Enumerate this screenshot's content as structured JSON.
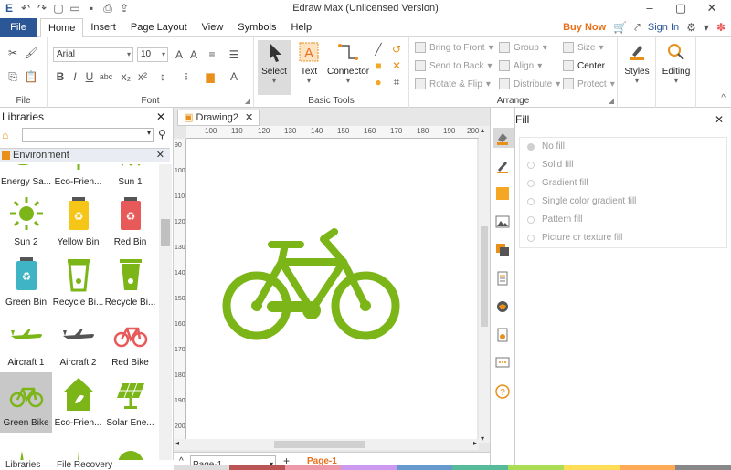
{
  "window": {
    "title": "Edraw Max (Unlicensed Version)"
  },
  "menu": {
    "file": "File",
    "tabs": [
      "Home",
      "Insert",
      "Page Layout",
      "View",
      "Symbols",
      "Help"
    ],
    "buy_now": "Buy Now",
    "sign_in": "Sign In"
  },
  "ribbon": {
    "file_group": "File",
    "font_group": "Font",
    "font_name": "Arial",
    "font_size": "10",
    "basic_tools_group": "Basic Tools",
    "select": "Select",
    "text": "Text",
    "connector": "Connector",
    "arrange_group": "Arrange",
    "bring_to_front": "Bring to Front",
    "send_to_back": "Send to Back",
    "rotate_flip": "Rotate & Flip",
    "group": "Group",
    "align": "Align",
    "distribute": "Distribute",
    "size": "Size",
    "center": "Center",
    "protect": "Protect",
    "styles": "Styles",
    "editing": "Editing"
  },
  "libraries": {
    "title": "Libraries",
    "category": "Environment",
    "items": [
      {
        "name": "Energy Sa..."
      },
      {
        "name": "Eco-Frien..."
      },
      {
        "name": "Sun 1"
      },
      {
        "name": "Sun 2"
      },
      {
        "name": "Yellow Bin"
      },
      {
        "name": "Red Bin"
      },
      {
        "name": "Green Bin"
      },
      {
        "name": "Recycle Bi..."
      },
      {
        "name": "Recycle Bi..."
      },
      {
        "name": "Aircraft 1"
      },
      {
        "name": "Aircraft 2"
      },
      {
        "name": "Red Bike"
      },
      {
        "name": "Green Bike"
      },
      {
        "name": "Eco-Frien..."
      },
      {
        "name": "Solar Ene..."
      }
    ],
    "footer_libraries": "Libraries",
    "footer_file_recovery": "File Recovery"
  },
  "document": {
    "tab": "Drawing2",
    "ruler_h": [
      "100",
      "110",
      "120",
      "130",
      "140",
      "150",
      "160",
      "170",
      "180",
      "190",
      "200"
    ],
    "ruler_v": [
      "90",
      "100",
      "110",
      "120",
      "130",
      "140",
      "150",
      "160",
      "170",
      "180",
      "190",
      "200"
    ],
    "page_select": "Page-1",
    "active_page": "Page-1"
  },
  "fill": {
    "title": "Fill",
    "options": [
      "No fill",
      "Solid fill",
      "Gradient fill",
      "Single color gradient fill",
      "Pattern fill",
      "Picture or texture fill"
    ],
    "selected_index": 0
  },
  "colors": {
    "bike_green": "#7cb518",
    "red": "#e85a5a",
    "yellow": "#f5c518",
    "teal": "#3fb4c4",
    "orange": "#e8901a"
  }
}
